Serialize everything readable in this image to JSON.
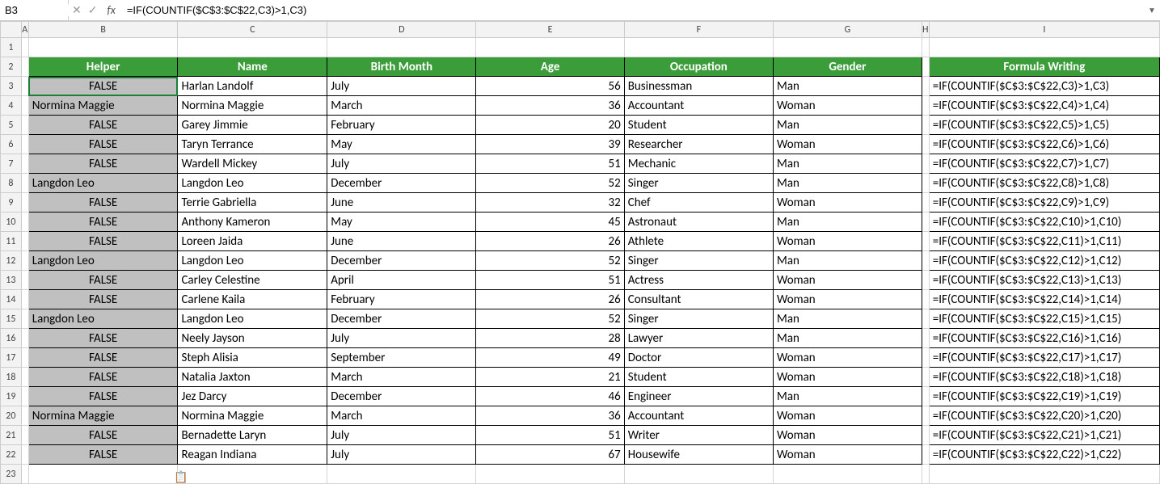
{
  "name_box": "B3",
  "formula_value": "=IF(COUNTIF($C$3:$C$22,C3)>1,C3)",
  "cols": [
    {
      "letter": "A",
      "class": "col-A"
    },
    {
      "letter": "B",
      "class": "col-B"
    },
    {
      "letter": "C",
      "class": "col-C"
    },
    {
      "letter": "D",
      "class": "col-D"
    },
    {
      "letter": "E",
      "class": "col-E"
    },
    {
      "letter": "F",
      "class": "col-F"
    },
    {
      "letter": "G",
      "class": "col-G"
    },
    {
      "letter": "H",
      "class": "col-H"
    },
    {
      "letter": "I",
      "class": "col-I"
    }
  ],
  "headers": {
    "B": "Helper",
    "C": "Name",
    "D": "Birth Month",
    "E": "Age",
    "F": "Occupation",
    "G": "Gender",
    "I": "Formula Writing"
  },
  "rows": [
    {
      "r": 3,
      "helper": "FALSE",
      "name": "Harlan Landolf",
      "month": "July",
      "age": 56,
      "occ": "Businessman",
      "gender": "Man",
      "formula": "=IF(COUNTIF($C$3:$C$22,C3)>1,C3)",
      "dup": false
    },
    {
      "r": 4,
      "helper": "Normina Maggie",
      "name": "Normina Maggie",
      "month": "March",
      "age": 36,
      "occ": "Accountant",
      "gender": "Woman",
      "formula": "=IF(COUNTIF($C$3:$C$22,C4)>1,C4)",
      "dup": true
    },
    {
      "r": 5,
      "helper": "FALSE",
      "name": "Garey Jimmie",
      "month": "February",
      "age": 20,
      "occ": "Student",
      "gender": "Man",
      "formula": "=IF(COUNTIF($C$3:$C$22,C5)>1,C5)",
      "dup": false
    },
    {
      "r": 6,
      "helper": "FALSE",
      "name": "Taryn Terrance",
      "month": "May",
      "age": 39,
      "occ": "Researcher",
      "gender": "Woman",
      "formula": "=IF(COUNTIF($C$3:$C$22,C6)>1,C6)",
      "dup": false
    },
    {
      "r": 7,
      "helper": "FALSE",
      "name": "Wardell Mickey",
      "month": "July",
      "age": 51,
      "occ": "Mechanic",
      "gender": "Man",
      "formula": "=IF(COUNTIF($C$3:$C$22,C7)>1,C7)",
      "dup": false
    },
    {
      "r": 8,
      "helper": "Langdon Leo",
      "name": "Langdon Leo",
      "month": "December",
      "age": 52,
      "occ": "Singer",
      "gender": "Man",
      "formula": "=IF(COUNTIF($C$3:$C$22,C8)>1,C8)",
      "dup": true
    },
    {
      "r": 9,
      "helper": "FALSE",
      "name": "Terrie Gabriella",
      "month": "June",
      "age": 32,
      "occ": "Chef",
      "gender": "Woman",
      "formula": "=IF(COUNTIF($C$3:$C$22,C9)>1,C9)",
      "dup": false
    },
    {
      "r": 10,
      "helper": "FALSE",
      "name": "Anthony Kameron",
      "month": "May",
      "age": 45,
      "occ": "Astronaut",
      "gender": "Man",
      "formula": "=IF(COUNTIF($C$3:$C$22,C10)>1,C10)",
      "dup": false
    },
    {
      "r": 11,
      "helper": "FALSE",
      "name": "Loreen Jaida",
      "month": "June",
      "age": 26,
      "occ": "Athlete",
      "gender": "Woman",
      "formula": "=IF(COUNTIF($C$3:$C$22,C11)>1,C11)",
      "dup": false
    },
    {
      "r": 12,
      "helper": "Langdon Leo",
      "name": "Langdon Leo",
      "month": "December",
      "age": 52,
      "occ": "Singer",
      "gender": "Man",
      "formula": "=IF(COUNTIF($C$3:$C$22,C12)>1,C12)",
      "dup": true
    },
    {
      "r": 13,
      "helper": "FALSE",
      "name": "Carley Celestine",
      "month": "April",
      "age": 51,
      "occ": "Actress",
      "gender": "Woman",
      "formula": "=IF(COUNTIF($C$3:$C$22,C13)>1,C13)",
      "dup": false
    },
    {
      "r": 14,
      "helper": "FALSE",
      "name": "Carlene Kaila",
      "month": "February",
      "age": 26,
      "occ": "Consultant",
      "gender": "Woman",
      "formula": "=IF(COUNTIF($C$3:$C$22,C14)>1,C14)",
      "dup": false
    },
    {
      "r": 15,
      "helper": "Langdon Leo",
      "name": "Langdon Leo",
      "month": "December",
      "age": 52,
      "occ": "Singer",
      "gender": "Man",
      "formula": "=IF(COUNTIF($C$3:$C$22,C15)>1,C15)",
      "dup": true
    },
    {
      "r": 16,
      "helper": "FALSE",
      "name": "Neely Jayson",
      "month": "July",
      "age": 28,
      "occ": "Lawyer",
      "gender": "Man",
      "formula": "=IF(COUNTIF($C$3:$C$22,C16)>1,C16)",
      "dup": false
    },
    {
      "r": 17,
      "helper": "FALSE",
      "name": "Steph Alisia",
      "month": "September",
      "age": 49,
      "occ": "Doctor",
      "gender": "Woman",
      "formula": "=IF(COUNTIF($C$3:$C$22,C17)>1,C17)",
      "dup": false
    },
    {
      "r": 18,
      "helper": "FALSE",
      "name": "Natalia Jaxton",
      "month": "March",
      "age": 21,
      "occ": "Student",
      "gender": "Woman",
      "formula": "=IF(COUNTIF($C$3:$C$22,C18)>1,C18)",
      "dup": false
    },
    {
      "r": 19,
      "helper": "FALSE",
      "name": "Jez Darcy",
      "month": "December",
      "age": 46,
      "occ": "Engineer",
      "gender": "Man",
      "formula": "=IF(COUNTIF($C$3:$C$22,C19)>1,C19)",
      "dup": false
    },
    {
      "r": 20,
      "helper": "Normina Maggie",
      "name": "Normina Maggie",
      "month": "March",
      "age": 36,
      "occ": "Accountant",
      "gender": "Woman",
      "formula": "=IF(COUNTIF($C$3:$C$22,C20)>1,C20)",
      "dup": true
    },
    {
      "r": 21,
      "helper": "FALSE",
      "name": "Bernadette Laryn",
      "month": "July",
      "age": 51,
      "occ": "Writer",
      "gender": "Woman",
      "formula": "=IF(COUNTIF($C$3:$C$22,C21)>1,C21)",
      "dup": false
    },
    {
      "r": 22,
      "helper": "FALSE",
      "name": "Reagan Indiana",
      "month": "July",
      "age": 67,
      "occ": "Housewife",
      "gender": "Woman",
      "formula": "=IF(COUNTIF($C$3:$C$22,C22)>1,C22)",
      "dup": false
    }
  ],
  "selected_cell": "B3"
}
